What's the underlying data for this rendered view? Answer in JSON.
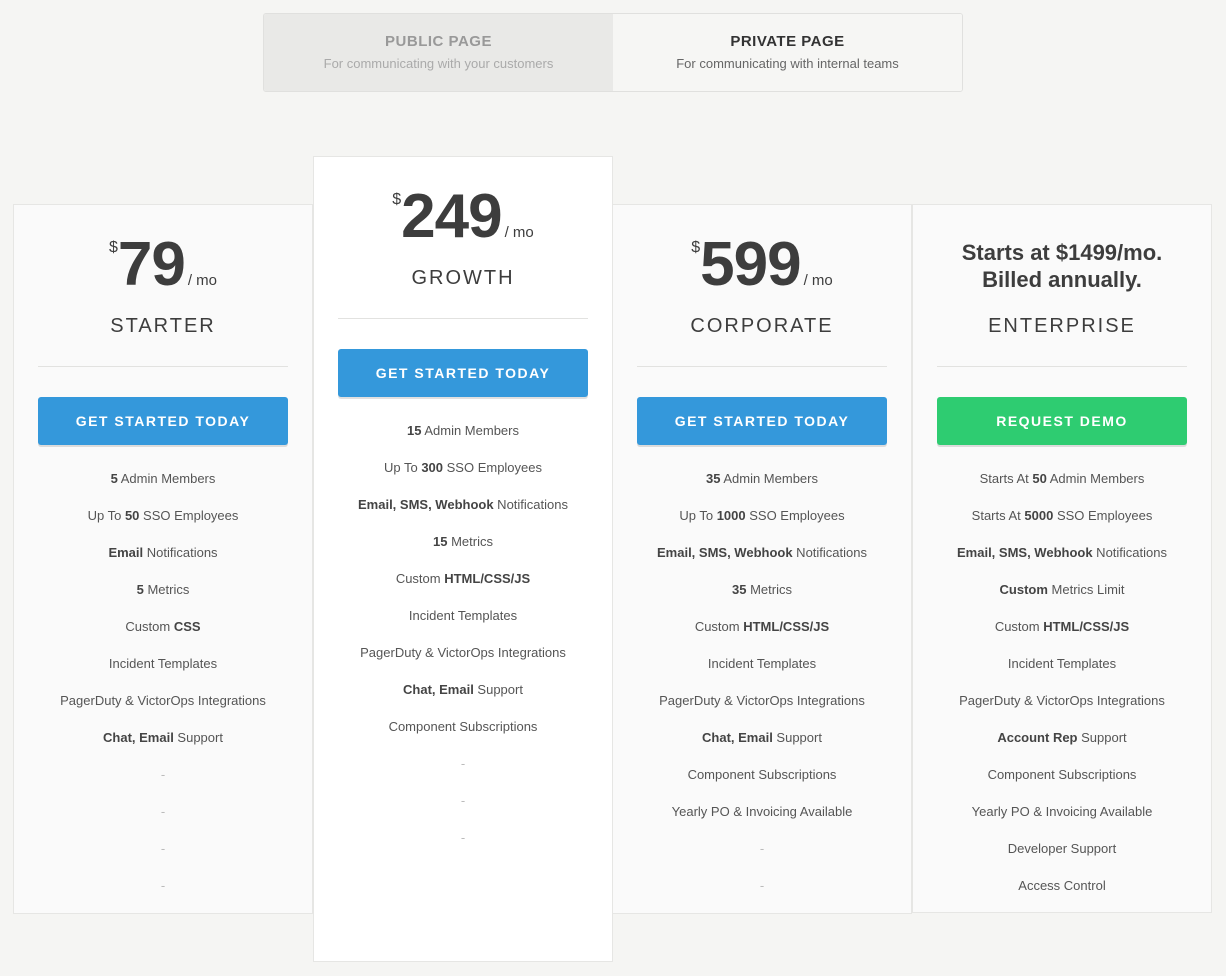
{
  "toggle": [
    {
      "title": "PUBLIC PAGE",
      "subtitle": "For communicating with your customers",
      "active": false
    },
    {
      "title": "PRIVATE PAGE",
      "subtitle": "For communicating with internal teams",
      "active": true
    }
  ],
  "colors": {
    "primary": "#3498db",
    "demo": "#2ecc71"
  },
  "plans": [
    {
      "currency": "$",
      "amount": "79",
      "period": "/ mo",
      "name": "STARTER",
      "button": "GET STARTED TODAY",
      "features": [
        [
          {
            "t": "5",
            "b": true
          },
          {
            "t": " Admin Members"
          }
        ],
        [
          {
            "t": "Up To "
          },
          {
            "t": "50",
            "b": true
          },
          {
            "t": " SSO Employees"
          }
        ],
        [
          {
            "t": "Email",
            "b": true
          },
          {
            "t": " Notifications"
          }
        ],
        [
          {
            "t": "5",
            "b": true
          },
          {
            "t": " Metrics"
          }
        ],
        [
          {
            "t": "Custom "
          },
          {
            "t": "CSS",
            "b": true
          }
        ],
        [
          {
            "t": "Incident Templates"
          }
        ],
        [
          {
            "t": "PagerDuty & VictorOps Integrations"
          }
        ],
        [
          {
            "t": "Chat, Email",
            "b": true
          },
          {
            "t": " Support"
          }
        ],
        [
          {
            "t": "-",
            "d": true
          }
        ],
        [
          {
            "t": "-",
            "d": true
          }
        ],
        [
          {
            "t": "-",
            "d": true
          }
        ],
        [
          {
            "t": "-",
            "d": true
          }
        ]
      ]
    },
    {
      "currency": "$",
      "amount": "249",
      "period": "/ mo",
      "name": "GROWTH",
      "button": "GET STARTED TODAY",
      "features": [
        [
          {
            "t": "15",
            "b": true
          },
          {
            "t": " Admin Members"
          }
        ],
        [
          {
            "t": "Up To "
          },
          {
            "t": "300",
            "b": true
          },
          {
            "t": " SSO Employees"
          }
        ],
        [
          {
            "t": "Email, SMS, Webhook",
            "b": true
          },
          {
            "t": " Notifications"
          }
        ],
        [
          {
            "t": "15",
            "b": true
          },
          {
            "t": " Metrics"
          }
        ],
        [
          {
            "t": "Custom "
          },
          {
            "t": "HTML/CSS/JS",
            "b": true
          }
        ],
        [
          {
            "t": "Incident Templates"
          }
        ],
        [
          {
            "t": "PagerDuty & VictorOps Integrations"
          }
        ],
        [
          {
            "t": "Chat, Email",
            "b": true
          },
          {
            "t": " Support"
          }
        ],
        [
          {
            "t": "Component Subscriptions"
          }
        ],
        [
          {
            "t": "-",
            "d": true
          }
        ],
        [
          {
            "t": "-",
            "d": true
          }
        ],
        [
          {
            "t": "-",
            "d": true
          }
        ]
      ]
    },
    {
      "currency": "$",
      "amount": "599",
      "period": "/ mo",
      "name": "CORPORATE",
      "button": "GET STARTED TODAY",
      "features": [
        [
          {
            "t": "35",
            "b": true
          },
          {
            "t": " Admin Members"
          }
        ],
        [
          {
            "t": "Up To "
          },
          {
            "t": "1000",
            "b": true
          },
          {
            "t": " SSO Employees"
          }
        ],
        [
          {
            "t": "Email, SMS, Webhook",
            "b": true
          },
          {
            "t": " Notifications"
          }
        ],
        [
          {
            "t": "35",
            "b": true
          },
          {
            "t": " Metrics"
          }
        ],
        [
          {
            "t": "Custom "
          },
          {
            "t": "HTML/CSS/JS",
            "b": true
          }
        ],
        [
          {
            "t": "Incident Templates"
          }
        ],
        [
          {
            "t": "PagerDuty & VictorOps Integrations"
          }
        ],
        [
          {
            "t": "Chat, Email",
            "b": true
          },
          {
            "t": " Support"
          }
        ],
        [
          {
            "t": "Component Subscriptions"
          }
        ],
        [
          {
            "t": "Yearly PO & Invoicing Available"
          }
        ],
        [
          {
            "t": "-",
            "d": true
          }
        ],
        [
          {
            "t": "-",
            "d": true
          }
        ]
      ]
    },
    {
      "headline": [
        "Starts at $1499/mo.",
        "Billed annually."
      ],
      "name": "ENTERPRISE",
      "button": "REQUEST DEMO",
      "features": [
        [
          {
            "t": "Starts At "
          },
          {
            "t": "50",
            "b": true
          },
          {
            "t": " Admin Members"
          }
        ],
        [
          {
            "t": "Starts At "
          },
          {
            "t": "5000",
            "b": true
          },
          {
            "t": " SSO Employees"
          }
        ],
        [
          {
            "t": "Email, SMS, Webhook",
            "b": true
          },
          {
            "t": " Notifications"
          }
        ],
        [
          {
            "t": "Custom",
            "b": true
          },
          {
            "t": " Metrics Limit"
          }
        ],
        [
          {
            "t": "Custom "
          },
          {
            "t": "HTML/CSS/JS",
            "b": true
          }
        ],
        [
          {
            "t": "Incident Templates"
          }
        ],
        [
          {
            "t": "PagerDuty & VictorOps Integrations"
          }
        ],
        [
          {
            "t": "Account Rep",
            "b": true
          },
          {
            "t": " Support"
          }
        ],
        [
          {
            "t": "Component Subscriptions"
          }
        ],
        [
          {
            "t": "Yearly PO & Invoicing Available"
          }
        ],
        [
          {
            "t": "Developer Support"
          }
        ],
        [
          {
            "t": "Access Control"
          }
        ]
      ]
    }
  ]
}
